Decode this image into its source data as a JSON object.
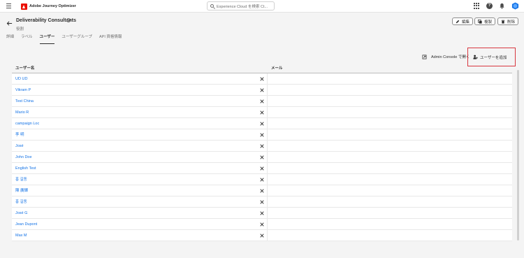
{
  "app": {
    "name": "Adobe Journey Optimizer"
  },
  "search": {
    "placeholder": "Experience Cloud を検索 Ct..."
  },
  "header": {
    "title": "Deliverability Consultants",
    "subtitle": "役割"
  },
  "actions": {
    "edit": "編集",
    "duplicate": "複製",
    "delete": "削除"
  },
  "tabs": [
    {
      "label": "詳細"
    },
    {
      "label": "ラベル"
    },
    {
      "label": "ユーザー"
    },
    {
      "label": "ユーザーグループ"
    },
    {
      "label": "API 資格情報"
    }
  ],
  "admin_console_link": "Admin Console で開く",
  "add_user_label": "ユーザーを追加",
  "table": {
    "columns": {
      "name": "ユーザー名",
      "email": "メール"
    },
    "rows": [
      {
        "name": "UD UD"
      },
      {
        "name": "Vikram P"
      },
      {
        "name": "Test China"
      },
      {
        "name": "Mario R"
      },
      {
        "name": "campaign Loc"
      },
      {
        "name": "李 明"
      },
      {
        "name": "José"
      },
      {
        "name": "John Doe"
      },
      {
        "name": "English Test"
      },
      {
        "name": "홍 길동"
      },
      {
        "name": "陳 廣輝"
      },
      {
        "name": "홍 길동"
      },
      {
        "name": "José G"
      },
      {
        "name": "Jean Dupont"
      },
      {
        "name": "Max M"
      }
    ]
  },
  "colors": {
    "accent": "#1473e6",
    "brand": "#eb1000",
    "highlight": "#d7373f"
  }
}
